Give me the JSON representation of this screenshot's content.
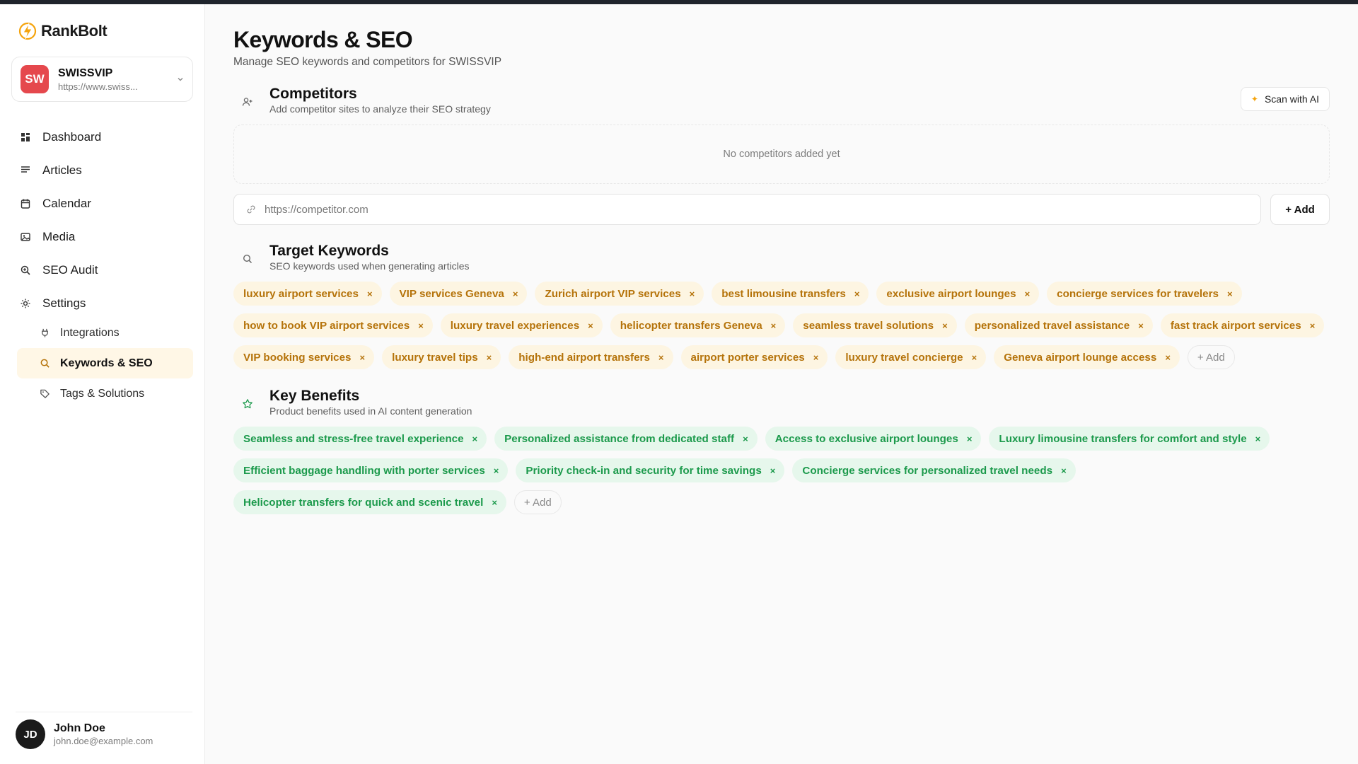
{
  "app": {
    "name": "RankBolt"
  },
  "site": {
    "initials": "SW",
    "name": "SWISSVIP",
    "url": "https://www.swiss..."
  },
  "nav": {
    "items": [
      {
        "label": "Dashboard",
        "icon": "dashboard-icon"
      },
      {
        "label": "Articles",
        "icon": "articles-icon"
      },
      {
        "label": "Calendar",
        "icon": "calendar-icon"
      },
      {
        "label": "Media",
        "icon": "media-icon"
      },
      {
        "label": "SEO Audit",
        "icon": "seo-audit-icon"
      },
      {
        "label": "Settings",
        "icon": "settings-icon"
      }
    ],
    "sub_items": [
      {
        "label": "Integrations",
        "icon": "plug-icon"
      },
      {
        "label": "Keywords & SEO",
        "icon": "search-icon",
        "active": true
      },
      {
        "label": "Tags & Solutions",
        "icon": "tag-icon"
      }
    ]
  },
  "user": {
    "initials": "JD",
    "name": "John Doe",
    "email": "john.doe@example.com"
  },
  "page": {
    "title": "Keywords & SEO",
    "subtitle": "Manage SEO keywords and competitors for SWISSVIP"
  },
  "competitors": {
    "title": "Competitors",
    "description": "Add competitor sites to analyze their SEO strategy",
    "scan_label": "Scan with AI",
    "empty_text": "No competitors added yet",
    "input_placeholder": "https://competitor.com",
    "add_label": "+ Add"
  },
  "keywords": {
    "title": "Target Keywords",
    "description": "SEO keywords used when generating articles",
    "items": [
      "luxury airport services",
      "VIP services Geneva",
      "Zurich airport VIP services",
      "best limousine transfers",
      "exclusive airport lounges",
      "concierge services for travelers",
      "how to book VIP airport services",
      "luxury travel experiences",
      "helicopter transfers Geneva",
      "seamless travel solutions",
      "personalized travel assistance",
      "fast track airport services",
      "VIP booking services",
      "luxury travel tips",
      "high-end airport transfers",
      "airport porter services",
      "luxury travel concierge",
      "Geneva airport lounge access"
    ],
    "add_label": "+ Add"
  },
  "benefits": {
    "title": "Key Benefits",
    "description": "Product benefits used in AI content generation",
    "items": [
      "Seamless and stress-free travel experience",
      "Personalized assistance from dedicated staff",
      "Access to exclusive airport lounges",
      "Luxury limousine transfers for comfort and style",
      "Efficient baggage handling with porter services",
      "Priority check-in and security for time savings",
      "Concierge services for personalized travel needs",
      "Helicopter transfers for quick and scenic travel"
    ],
    "add_label": "+ Add"
  },
  "remove_glyph": "×",
  "colors": {
    "accent": "#f5a30b",
    "keyword_bg": "#fdf5e2",
    "keyword_text": "#b5730a",
    "benefit_bg": "#e6f7ec",
    "benefit_text": "#1c9a4c",
    "site_avatar": "#e5484d",
    "active_nav_bg": "#fff7e6"
  }
}
